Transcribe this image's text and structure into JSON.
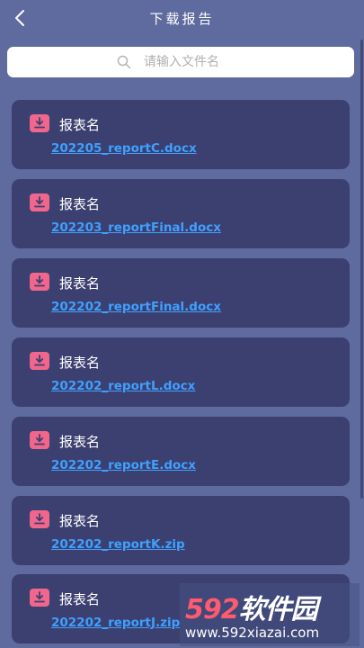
{
  "header": {
    "title": "下载报告"
  },
  "search": {
    "placeholder": "请输入文件名"
  },
  "reports": [
    {
      "label": "报表名",
      "filename": "202205_reportC.docx"
    },
    {
      "label": "报表名",
      "filename": "202203_reportFinal.docx"
    },
    {
      "label": "报表名",
      "filename": "202202_reportFinal.docx"
    },
    {
      "label": "报表名",
      "filename": "202202_reportL.docx"
    },
    {
      "label": "报表名",
      "filename": "202202_reportE.docx"
    },
    {
      "label": "报表名",
      "filename": "202202_reportK.zip"
    },
    {
      "label": "报表名",
      "filename": "202202_reportJ.zip"
    }
  ],
  "watermark": {
    "number": "592",
    "name": "软件园",
    "url": "www.592xiazai.com"
  },
  "colors": {
    "background": "#5f6a9f",
    "card": "#3b4070",
    "accent_pink": "#f0668c",
    "link_blue": "#3fa0ff"
  }
}
